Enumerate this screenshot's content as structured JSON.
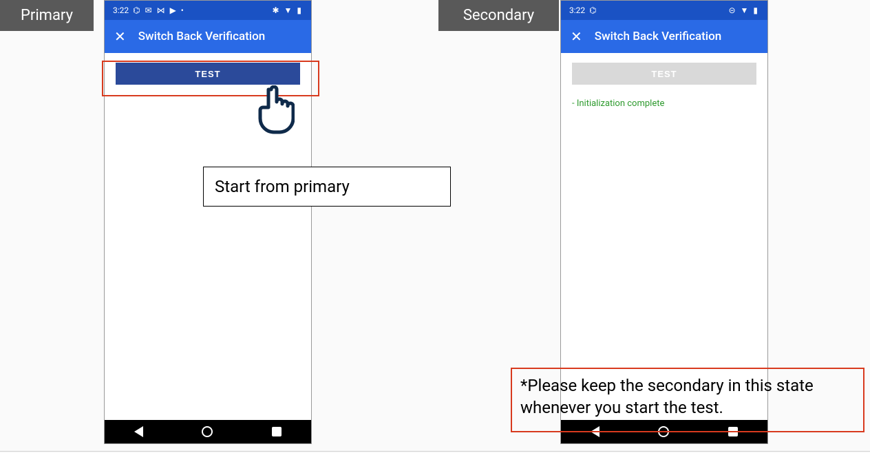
{
  "labels": {
    "primary": "Primary",
    "secondary": "Secondary"
  },
  "primary": {
    "status": {
      "time": "3:22",
      "left_icons": "⌬ ✉ ⋈ ▶ •",
      "right_icons": "✱ ▼ ▮"
    },
    "appbar": {
      "title": "Switch Back Verification"
    },
    "test_button": "TEST"
  },
  "secondary": {
    "status": {
      "time": "3:22",
      "left_icons": "⌬",
      "right_icons": "⊝ ▼ ▮"
    },
    "appbar": {
      "title": "Switch Back Verification"
    },
    "test_button": "TEST",
    "log": "- Initialization complete"
  },
  "captions": {
    "primary": "Start from primary",
    "secondary": "*Please keep the secondary in this state whenever you start the test."
  }
}
